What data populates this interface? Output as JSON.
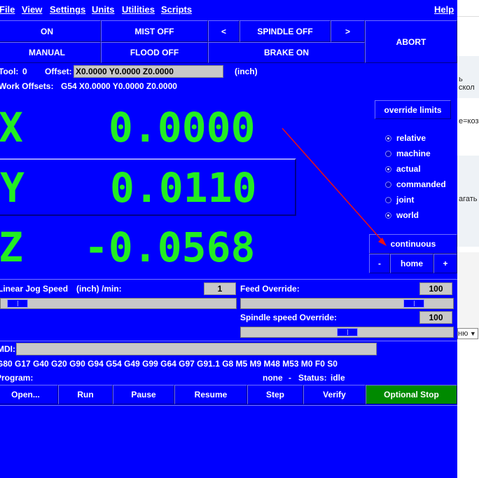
{
  "menu": [
    "File",
    "View",
    "Settings",
    "Units",
    "Utilities",
    "Scripts",
    "Help"
  ],
  "buttons": {
    "on": "ON",
    "mist": "MIST OFF",
    "spindle_prev": "<",
    "spindle": "SPINDLE OFF",
    "spindle_next": ">",
    "abort": "ABORT",
    "manual": "MANUAL",
    "flood": "FLOOD OFF",
    "brake": "BRAKE ON"
  },
  "tool_line": {
    "tool_label": "Tool:",
    "tool_value": "0",
    "offset_label": "Offset:",
    "offset_value": "X0.0000 Y0.0000 Z0.0000",
    "unit": "(inch)"
  },
  "work_offsets": {
    "label": "Work Offsets:",
    "value": "G54 X0.0000 Y0.0000 Z0.0000"
  },
  "dro": {
    "x": {
      "axis": "X",
      "value": "0.0000"
    },
    "y": {
      "axis": "Y",
      "value": "0.0110"
    },
    "z": {
      "axis": "Z",
      "value": "-0.0568"
    }
  },
  "right_panel": {
    "override_limits": "override limits",
    "radios": [
      {
        "label": "relative",
        "checked": true
      },
      {
        "label": "machine",
        "checked": false
      },
      {
        "label": "actual",
        "checked": true
      },
      {
        "label": "commanded",
        "checked": false
      },
      {
        "label": "joint",
        "checked": false
      },
      {
        "label": "world",
        "checked": true
      }
    ],
    "jog_mode": "continuous",
    "minus": "-",
    "home": "home",
    "plus": "+"
  },
  "jog": {
    "label": "Linear Jog Speed",
    "unit": "(inch) /min:",
    "value": "1",
    "position": 0.03
  },
  "feed": {
    "label": "Feed Override:",
    "value": "100",
    "position": 0.85
  },
  "spindle_override": {
    "label": "Spindle speed Override:",
    "value": "100",
    "position": 0.5
  },
  "mdi": {
    "label": "MDI:",
    "value": ""
  },
  "gcodes": "G80 G17 G40 G20 G90 G94 G54 G49 G99 G64 G97 G91.1 G8 M5 M9 M48 M53 M0 F0 S0",
  "program": {
    "label": "Program:",
    "name": "none",
    "dash": "-",
    "status_label": "Status:",
    "status": "idle"
  },
  "program_buttons": [
    "Open...",
    "Run",
    "Pause",
    "Resume",
    "Step",
    "Verify",
    "Optional Stop"
  ],
  "colors": {
    "background": "#0000ff",
    "dro_text": "#22ee22",
    "optional_stop": "#008a00",
    "annotation_arrow": "#ee1111"
  },
  "background_window": {
    "fragments": [
      "ь скол",
      "е=коз",
      "агать",
      "ню"
    ]
  }
}
